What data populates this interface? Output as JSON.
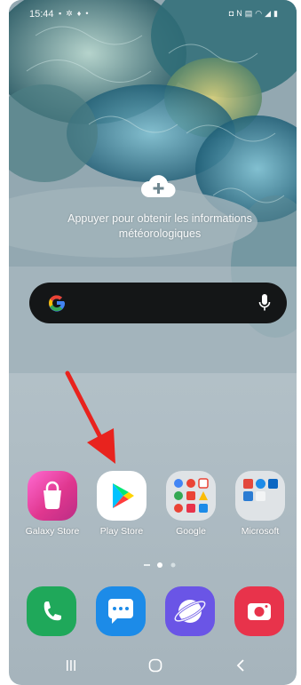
{
  "status_bar": {
    "time": "15:44",
    "left_icons": [
      "image-icon",
      "settings-icon",
      "location-icon",
      "dot-icon"
    ],
    "right_icons": [
      "alarm-icon",
      "nfc-icon",
      "lte-icon",
      "wifi-icon",
      "signal-icon",
      "battery-icon"
    ]
  },
  "weather_widget": {
    "add_icon": "cloud-plus-icon",
    "text": "Appuyer pour obtenir les informations météorologiques"
  },
  "search_bar": {
    "logo": "google-g-icon",
    "mic": "microphone-icon"
  },
  "apps": [
    {
      "label": "Galaxy Store",
      "icon": "shopping-bag-icon"
    },
    {
      "label": "Play Store",
      "icon": "play-triangle-icon"
    },
    {
      "label": "Google",
      "icon": "google-folder-icon"
    },
    {
      "label": "Microsoft",
      "icon": "microsoft-folder-icon"
    }
  ],
  "annotation": {
    "arrow_color": "#e8231e"
  },
  "page_indicator": {
    "pages": 3,
    "current": 2
  },
  "dock": [
    {
      "name": "phone",
      "icon": "phone-icon",
      "color": "#1fa85a"
    },
    {
      "name": "messages",
      "icon": "chat-bubble-icon",
      "color": "#1c8be8"
    },
    {
      "name": "internet",
      "icon": "planet-icon",
      "color": "#6a55e6"
    },
    {
      "name": "camera",
      "icon": "camera-icon",
      "color": "#e8334b"
    }
  ],
  "nav_bar": {
    "recents": "recents-icon",
    "home": "home-icon",
    "back": "back-icon"
  }
}
